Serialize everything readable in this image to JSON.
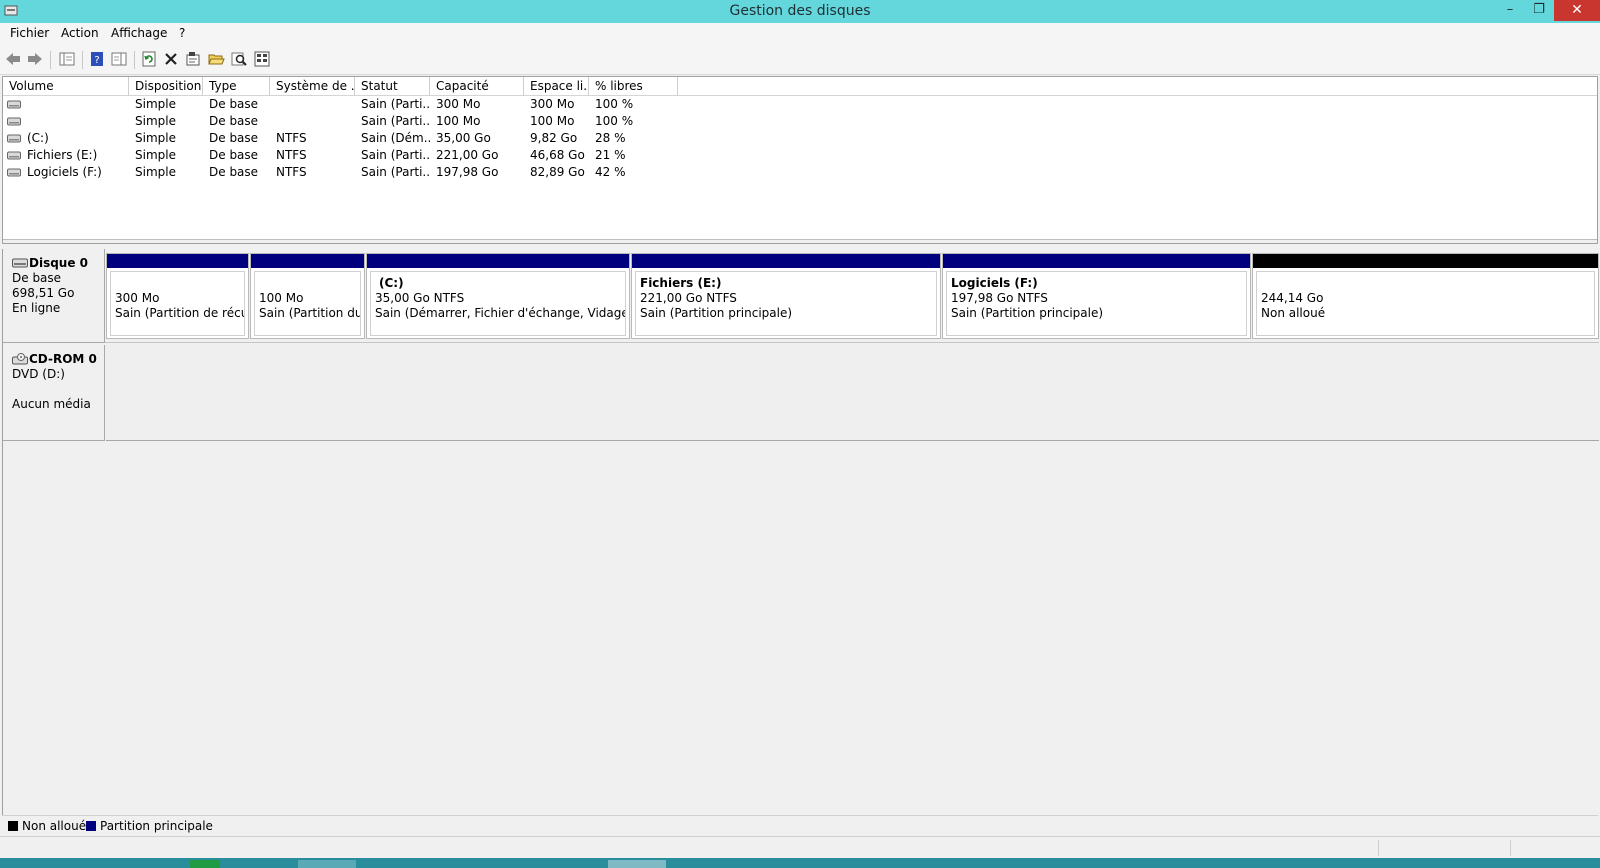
{
  "window": {
    "title": "Gestion des disques",
    "minimize_glyph": "–",
    "maximize_glyph": "❐",
    "close_glyph": "✕"
  },
  "menu": {
    "items": [
      "Fichier",
      "Action",
      "Affichage",
      "?"
    ]
  },
  "toolbar": {
    "icons": [
      "back-arrow-icon",
      "forward-arrow-icon",
      "console-tree-icon",
      "help-icon",
      "properties-pane-icon",
      "refresh-icon",
      "delete-icon",
      "properties-icon",
      "open-folder-icon",
      "search-icon",
      "export-list-icon"
    ]
  },
  "volume_list": {
    "columns": [
      "Volume",
      "Disposition",
      "Type",
      "Système de ...",
      "Statut",
      "Capacité",
      "Espace li...",
      "% libres"
    ],
    "rows": [
      {
        "volume": "",
        "disposition": "Simple",
        "type": "De base",
        "fs": "",
        "status": "Sain (Parti...",
        "capacity": "300 Mo",
        "free": "300 Mo",
        "pct": "100 %"
      },
      {
        "volume": "",
        "disposition": "Simple",
        "type": "De base",
        "fs": "",
        "status": "Sain (Parti...",
        "capacity": "100 Mo",
        "free": "100 Mo",
        "pct": "100 %"
      },
      {
        "volume": "(C:)",
        "disposition": "Simple",
        "type": "De base",
        "fs": "NTFS",
        "status": "Sain (Dém...",
        "capacity": "35,00 Go",
        "free": "9,82 Go",
        "pct": "28 %"
      },
      {
        "volume": "Fichiers (E:)",
        "disposition": "Simple",
        "type": "De base",
        "fs": "NTFS",
        "status": "Sain (Parti...",
        "capacity": "221,00 Go",
        "free": "46,68 Go",
        "pct": "21 %"
      },
      {
        "volume": "Logiciels (F:)",
        "disposition": "Simple",
        "type": "De base",
        "fs": "NTFS",
        "status": "Sain (Parti...",
        "capacity": "197,98 Go",
        "free": "82,89 Go",
        "pct": "42 %"
      }
    ]
  },
  "disks": [
    {
      "name": "Disque 0",
      "kind": "De base",
      "size": "698,51 Go",
      "state": "En ligne",
      "partitions": [
        {
          "name": "",
          "size": "300 Mo",
          "desc": "Sain (Partition de récupération)",
          "allocated": true
        },
        {
          "name": "",
          "size": "100 Mo",
          "desc": "Sain (Partition du système EFI)",
          "allocated": true
        },
        {
          "name": "(C:)",
          "size": "35,00 Go NTFS",
          "desc": "Sain (Démarrer, Fichier d'échange, Vidage sur incident)",
          "allocated": true
        },
        {
          "name": "Fichiers  (E:)",
          "size": "221,00 Go NTFS",
          "desc": "Sain (Partition principale)",
          "allocated": true
        },
        {
          "name": "Logiciels  (F:)",
          "size": "197,98 Go NTFS",
          "desc": "Sain (Partition principale)",
          "allocated": true
        },
        {
          "name": "",
          "size": "244,14 Go",
          "desc": "Non alloué",
          "allocated": false
        }
      ]
    },
    {
      "name": "CD-ROM 0",
      "kind": "DVD (D:)",
      "size": "",
      "state": "Aucun média"
    }
  ],
  "legend": {
    "items": [
      {
        "label": "Non alloué",
        "color": "#000000"
      },
      {
        "label": "Partition principale",
        "color": "#00007f"
      }
    ]
  },
  "colors": {
    "titlebar": "#63d7dc",
    "primary_partition": "#00007f",
    "unallocated": "#000000",
    "close_button": "#c9362f"
  }
}
